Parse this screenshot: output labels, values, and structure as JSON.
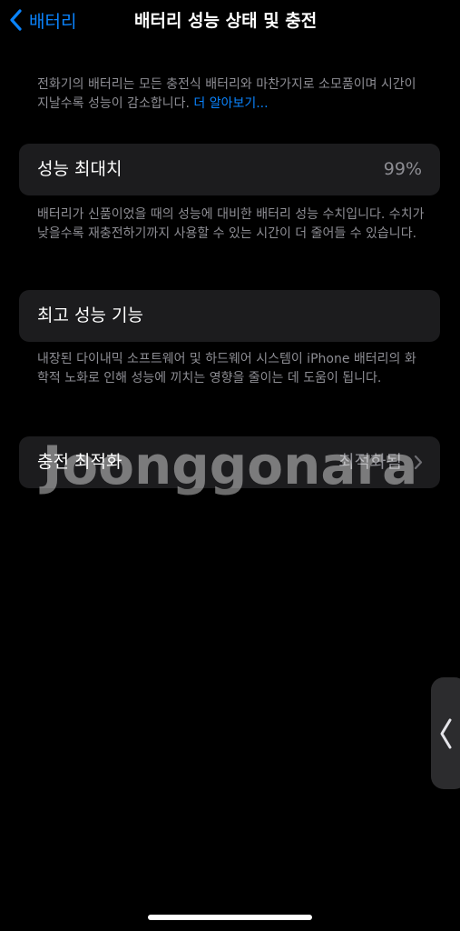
{
  "nav": {
    "back_label": "배터리",
    "title": "배터리 성능 상태 및 충전"
  },
  "intro": {
    "text": "전화기의 배터리는 모든 충전식 배터리와 마찬가지로 소모품이며 시간이 지날수록 성능이 감소합니다.",
    "link": "더 알아보기..."
  },
  "max_capacity": {
    "label": "성능 최대치",
    "value": "99%",
    "footer": "배터리가 신품이었을 때의 성능에 대비한 배터리 성능 수치입니다. 수치가 낮을수록 재충전하기까지 사용할 수 있는 시간이 더 줄어들 수 있습니다."
  },
  "peak_performance": {
    "label": "최고 성능 기능",
    "footer": "내장된 다이내믹 소프트웨어 및 하드웨어 시스템이 iPhone 배터리의 화학적 노화로 인해 성능에 끼치는 영향을 줄이는 데 도움이 됩니다."
  },
  "charging": {
    "label": "충전 최적화",
    "value": "최적화됨"
  },
  "watermark": "Joonggonara",
  "icons": {
    "back": "chevron-left-icon",
    "disclosure": "chevron-right-icon",
    "side_handle": "chevron-left-icon"
  },
  "colors": {
    "accent": "#0a84ff",
    "background": "#000000",
    "cell": "#1c1c1e",
    "secondary_text": "#8d8d93"
  }
}
